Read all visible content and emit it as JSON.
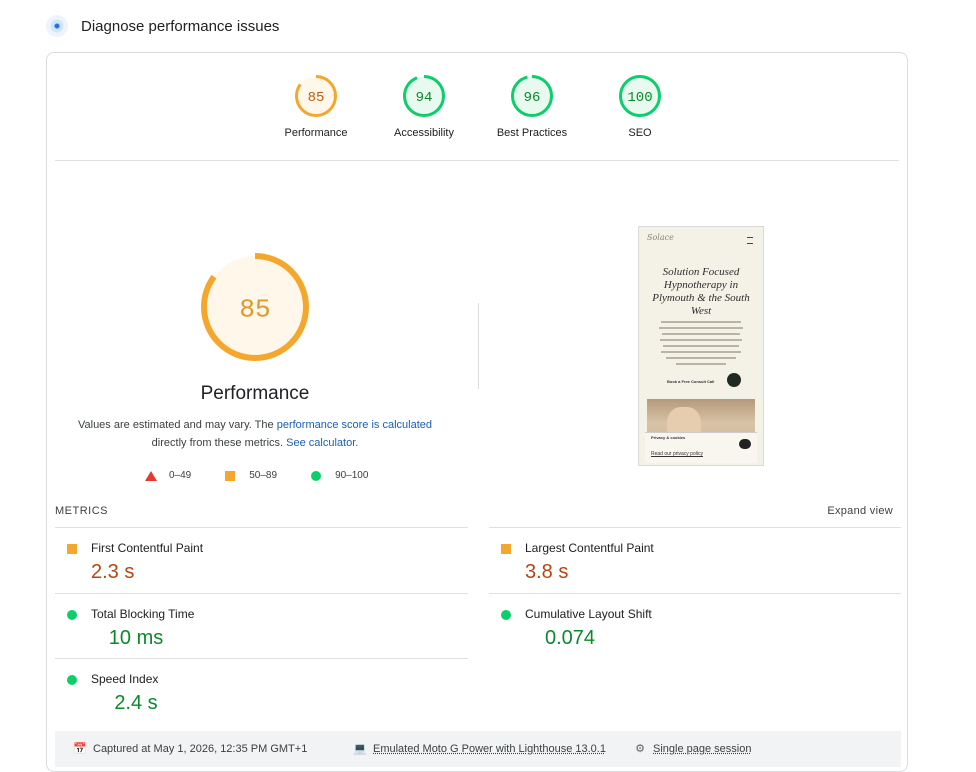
{
  "header": {
    "title": "Diagnose performance issues",
    "icon": "lighthouse-icon"
  },
  "gauges": [
    {
      "score": "85",
      "label": "Performance",
      "fraction": 0.85,
      "color": "#f4a72c",
      "textColor": "#c05a10",
      "bg": "#fff7ea"
    },
    {
      "score": "94",
      "label": "Accessibility",
      "fraction": 0.94,
      "color": "#0cce6b",
      "textColor": "#0a8a2a",
      "bg": "#e8f9ef"
    },
    {
      "score": "96",
      "label": "Best Practices",
      "fraction": 0.96,
      "color": "#0cce6b",
      "textColor": "#0a8a2a",
      "bg": "#e8f9ef"
    },
    {
      "score": "100",
      "label": "SEO",
      "fraction": 1.0,
      "color": "#0cce6b",
      "textColor": "#0a8a2a",
      "bg": "#e8f9ef"
    }
  ],
  "performance": {
    "score": "85",
    "fraction": 0.85,
    "title": "Performance",
    "note_part1": "Values are estimated and may vary. The ",
    "note_link1": "performance score is calculated",
    "note_part2": " directly from these metrics. ",
    "note_link2": "See calculator.",
    "legend": {
      "fail": "0–49",
      "average": "50–89",
      "pass": "90–100"
    }
  },
  "screenshot": {
    "logo": "Solace",
    "headline": "Solution Focused Hypnotherapy in Plymouth & the South West",
    "cta": "Book a Free Consult Call",
    "privacy_title": "Privacy & cookies",
    "privacy_link": "Read our privacy policy"
  },
  "metrics": {
    "heading": "METRICS",
    "expand_label": "Expand view",
    "items": [
      {
        "name": "First Contentful Paint",
        "value": "2.3 s",
        "rating": "average"
      },
      {
        "name": "Largest Contentful Paint",
        "value": "3.8 s",
        "rating": "average"
      },
      {
        "name": "Total Blocking Time",
        "value": "10 ms",
        "rating": "pass"
      },
      {
        "name": "Cumulative Layout Shift",
        "value": "0.074",
        "rating": "pass"
      },
      {
        "name": "Speed Index",
        "value": "2.4 s",
        "rating": "pass"
      }
    ]
  },
  "footer": {
    "captured": "Captured at May 1, 2026, 12:35 PM GMT+1",
    "device": "Emulated Moto G Power with Lighthouse 13.0.1",
    "session": "Single page session"
  }
}
